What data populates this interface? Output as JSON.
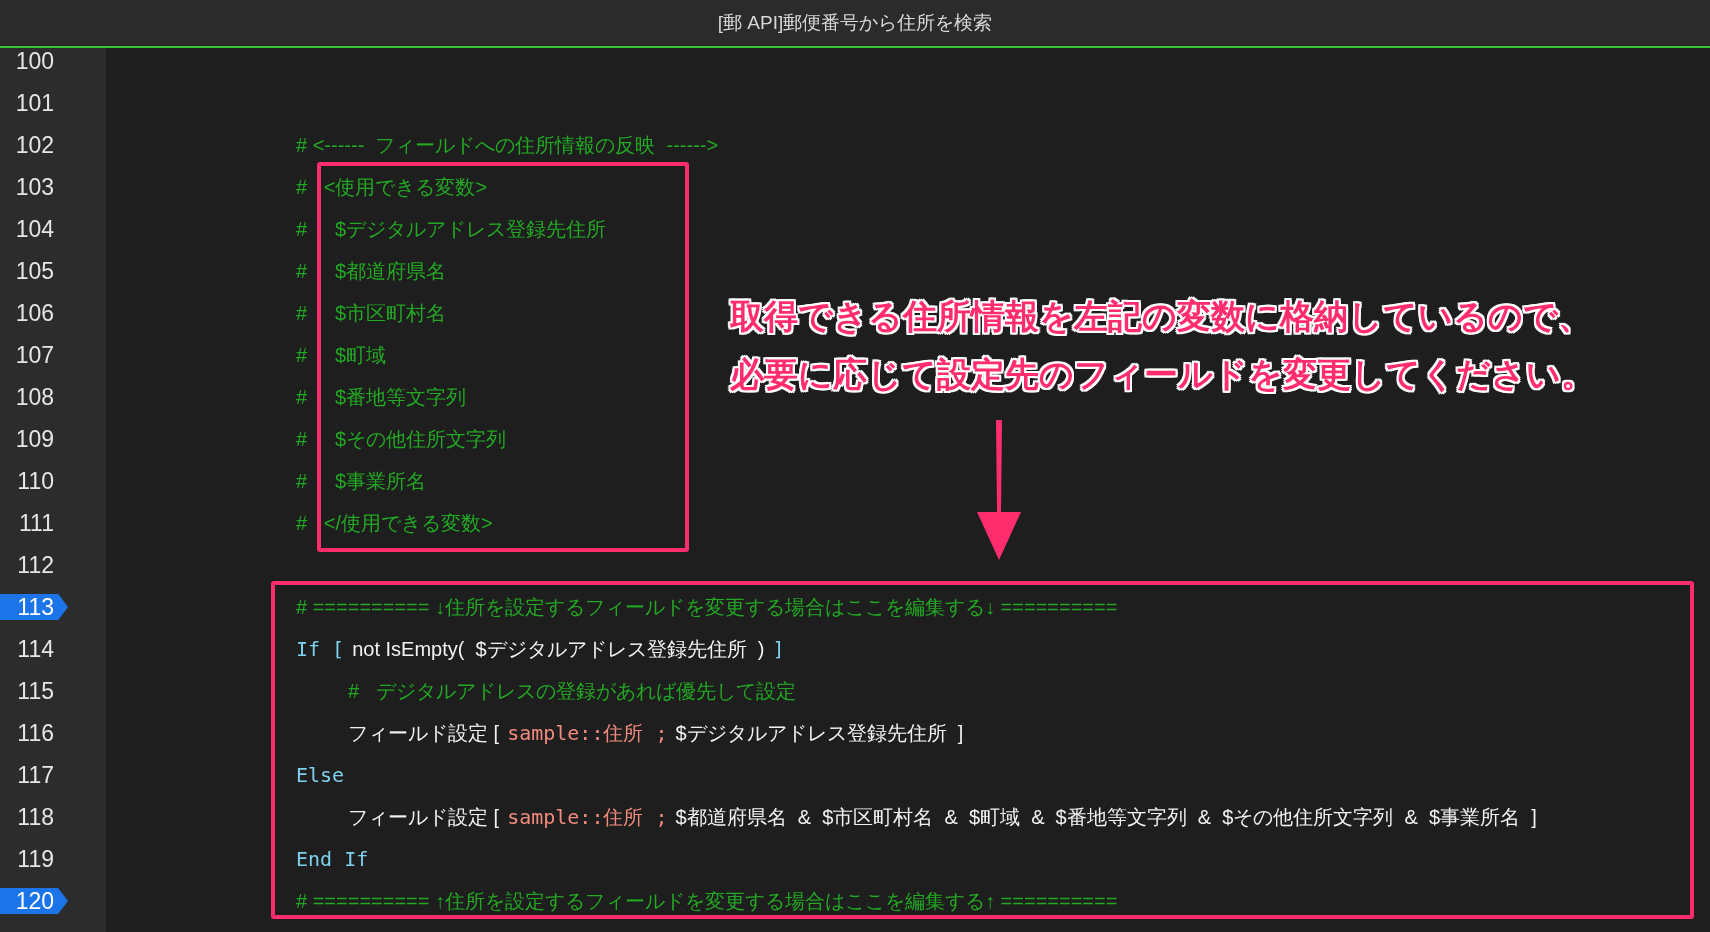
{
  "window": {
    "title": "[郵 API]郵便番号から住所を検索"
  },
  "script_steps": [
    {
      "number": "100",
      "breakpoint": false
    },
    {
      "number": "101",
      "breakpoint": false
    },
    {
      "number": "102",
      "breakpoint": false,
      "segments": [
        {
          "kind": "comment",
          "text": "# <------  フィールドへの住所情報の反映  ------>"
        }
      ]
    },
    {
      "number": "103",
      "breakpoint": false,
      "segments": [
        {
          "kind": "comment",
          "text": "#   <使用できる変数>"
        }
      ]
    },
    {
      "number": "104",
      "breakpoint": false,
      "segments": [
        {
          "kind": "comment",
          "text": "#     $デジタルアドレス登録先住所"
        }
      ]
    },
    {
      "number": "105",
      "breakpoint": false,
      "segments": [
        {
          "kind": "comment",
          "text": "#     $都道府県名"
        }
      ]
    },
    {
      "number": "106",
      "breakpoint": false,
      "segments": [
        {
          "kind": "comment",
          "text": "#     $市区町村名"
        }
      ]
    },
    {
      "number": "107",
      "breakpoint": false,
      "segments": [
        {
          "kind": "comment",
          "text": "#     $町域"
        }
      ]
    },
    {
      "number": "108",
      "breakpoint": false,
      "segments": [
        {
          "kind": "comment",
          "text": "#     $番地等文字列"
        }
      ]
    },
    {
      "number": "109",
      "breakpoint": false,
      "segments": [
        {
          "kind": "comment",
          "text": "#     $その他住所文字列"
        }
      ]
    },
    {
      "number": "110",
      "breakpoint": false,
      "segments": [
        {
          "kind": "comment",
          "text": "#     $事業所名"
        }
      ]
    },
    {
      "number": "111",
      "breakpoint": false,
      "segments": [
        {
          "kind": "comment",
          "text": "#   </使用できる変数>"
        }
      ]
    },
    {
      "number": "112",
      "breakpoint": false
    },
    {
      "number": "113",
      "breakpoint": true,
      "segments": [
        {
          "kind": "comment",
          "text": "# ========== ↓住所を設定するフィールドを変更する場合はここを編集する↓ =========="
        }
      ]
    },
    {
      "number": "114",
      "breakpoint": false,
      "segments": [
        {
          "kind": "keyword",
          "text": "If ["
        },
        {
          "kind": "plain",
          "text": "not IsEmpty(  $デジタルアドレス登録先住所  )"
        },
        {
          "kind": "keyword",
          "text": "]"
        }
      ],
      "children": [
        {
          "number": "115",
          "breakpoint": false,
          "segments": [
            {
              "kind": "comment",
              "text": "#   デジタルアドレスの登録があれば優先して設定"
            }
          ]
        },
        {
          "number": "116",
          "breakpoint": false,
          "segments": [
            {
              "kind": "plain",
              "text": "フィールド設定 ["
            },
            {
              "kind": "field",
              "text": "sample::住所 ;"
            },
            {
              "kind": "plain",
              "text": "$デジタルアドレス登録先住所  ]"
            }
          ]
        }
      ]
    },
    {
      "number": "117",
      "breakpoint": false,
      "segments": [
        {
          "kind": "keyword",
          "text": "Else"
        }
      ],
      "children": [
        {
          "number": "118",
          "breakpoint": false,
          "segments": [
            {
              "kind": "plain",
              "text": "フィールド設定 ["
            },
            {
              "kind": "field",
              "text": "sample::住所 ;"
            },
            {
              "kind": "plain",
              "text": "$都道府県名  &  $市区町村名  &  $町域  &  $番地等文字列  &  $その他住所文字列  &  $事業所名  ]"
            }
          ]
        }
      ]
    },
    {
      "number": "119",
      "breakpoint": false,
      "segments": [
        {
          "kind": "keyword",
          "text": "End If"
        }
      ]
    },
    {
      "number": "120",
      "breakpoint": true,
      "segments": [
        {
          "kind": "comment",
          "text": "# ========== ↑住所を設定するフィールドを変更する場合はここを編集する↑ =========="
        }
      ]
    }
  ],
  "annotation": {
    "note_lines": [
      "取得できる住所情報を左記の変数に格納しているので、",
      "必要に応じて設定先のフィールドを変更してください。"
    ]
  }
}
